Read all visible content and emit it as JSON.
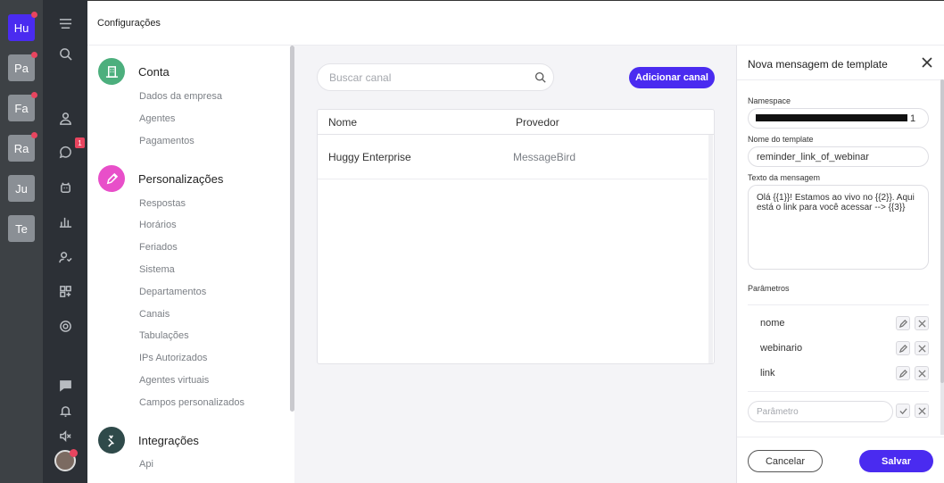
{
  "workspaces": [
    {
      "label": "Hu",
      "active": true,
      "unread": true
    },
    {
      "label": "Pa",
      "active": false,
      "unread": true
    },
    {
      "label": "Fa",
      "active": false,
      "unread": true
    },
    {
      "label": "Ra",
      "active": false,
      "unread": true
    },
    {
      "label": "Ju",
      "active": false,
      "unread": false
    },
    {
      "label": "Te",
      "active": false,
      "unread": false
    }
  ],
  "nav": {
    "chat_badge": "1",
    "icons": [
      "menu-icon",
      "search-icon",
      "contacts-icon",
      "chat-icon",
      "bot-icon",
      "reports-icon",
      "users-icon",
      "apps-icon",
      "settings-icon",
      "messages-icon",
      "bell-icon",
      "sound-off-icon"
    ]
  },
  "header": {
    "title": "Configurações"
  },
  "settings": {
    "sections": [
      {
        "title": "Conta",
        "items": [
          "Dados da empresa",
          "Agentes",
          "Pagamentos"
        ]
      },
      {
        "title": "Personalizações",
        "items": [
          "Respostas",
          "Horários",
          "Feriados",
          "Sistema",
          "Departamentos",
          "Canais",
          "Tabulações",
          "IPs Autorizados",
          "Agentes virtuais",
          "Campos personalizados"
        ]
      },
      {
        "title": "Integrações",
        "items": [
          "Api"
        ]
      }
    ]
  },
  "channels": {
    "search_placeholder": "Buscar canal",
    "add_label": "Adicionar canal",
    "columns": [
      "Nome",
      "Provedor"
    ],
    "rows": [
      {
        "name": "Huggy Enterprise",
        "provider": "MessageBird"
      }
    ]
  },
  "panel": {
    "title": "Nova mensagem de template",
    "namespace_label": "Namespace",
    "namespace_value": "1",
    "template_name_label": "Nome do template",
    "template_name_value": "reminder_link_of_webinar",
    "message_label": "Texto da mensagem",
    "message_value": "Olá {{1}}! Estamos ao vivo no {{2}}. Aqui está o link para você acessar --> {{3}}",
    "params_label": "Parâmetros",
    "params": [
      "nome",
      "webinario",
      "link"
    ],
    "param_placeholder": "Parâmetro",
    "cancel_label": "Cancelar",
    "save_label": "Salvar"
  },
  "colors": {
    "accent": "#4a2bf0",
    "conta": "#4caf7d",
    "personalizacoes": "#e84fc9",
    "integracoes": "#2f4a4a"
  }
}
